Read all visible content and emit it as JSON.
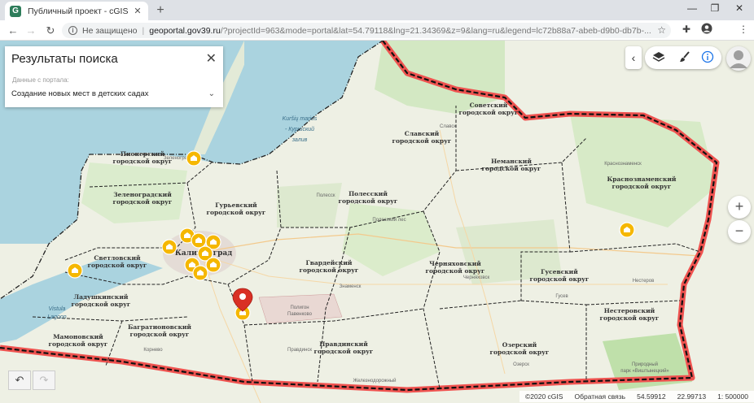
{
  "browser": {
    "tab_title": "Публичный проект - cGIS",
    "tab_favicon": "G",
    "tab_close": "✕",
    "new_tab": "+",
    "window_controls": [
      "—",
      "❐",
      "✕"
    ],
    "insecure_label": "Не защищено",
    "url_host": "geoportal.gov39.ru",
    "url_path": "/?projectId=963&mode=portal&lat=54.79118&lng=21.34369&z=9&lang=ru&legend=lc72b88a7-abeb-d9b0-db7b-..."
  },
  "search_panel": {
    "title": "Результаты поиска",
    "source_label": "Данные с портала:",
    "selected_layer": "Создание новых мест в детских садах"
  },
  "map": {
    "districts": [
      {
        "label_lines": [
          "Советский",
          "городской округ"
        ]
      },
      {
        "label_lines": [
          "Славский",
          "городской округ"
        ]
      },
      {
        "label_lines": [
          "Неманский",
          "городской округ"
        ]
      },
      {
        "label_lines": [
          "Краснознаменский",
          "городской округ"
        ]
      },
      {
        "label_lines": [
          "Пионерский",
          "городской округ"
        ]
      },
      {
        "label_lines": [
          "Зеленоградский",
          "городской округ"
        ]
      },
      {
        "label_lines": [
          "Гурьевский",
          "городской округ"
        ]
      },
      {
        "label_lines": [
          "Полесский",
          "городской округ"
        ]
      },
      {
        "label_lines": [
          "Светловский",
          "городской округ"
        ]
      },
      {
        "label_lines": [
          "Гвардейский",
          "городской округ"
        ]
      },
      {
        "label_lines": [
          "Черняховский",
          "городской округ"
        ]
      },
      {
        "label_lines": [
          "Гусевский",
          "городской округ"
        ]
      },
      {
        "label_lines": [
          "Ладушкинский",
          "городской округ"
        ]
      },
      {
        "label_lines": [
          "Нестеровский",
          "городской округ"
        ]
      },
      {
        "label_lines": [
          "Багратионовский",
          "городской округ"
        ]
      },
      {
        "label_lines": [
          "Мамоновский",
          "городской округ"
        ]
      },
      {
        "label_lines": [
          "Правдинский",
          "городской округ"
        ]
      },
      {
        "label_lines": [
          "Озерский",
          "городской округ"
        ]
      }
    ],
    "water_labels": [
      "Kuršių marios",
      "- Куршский",
      "залив"
    ],
    "city_label": "Калининград",
    "polygon_label": [
      "Полигон",
      "Павенково"
    ],
    "park_label": [
      "Природный",
      "парк «Виштынецкий»"
    ],
    "small_labels": [
      "Славск",
      "Краснознаменск",
      "Полесск",
      "Знаменск",
      "Черняховск",
      "Нестеров",
      "Гусев",
      "Озерск",
      "Железнодорожный",
      "Правдинск",
      "Корнево",
      "Полесский лес",
      "Зеленоградск"
    ],
    "vistula_label": [
      "Vistula",
      "Lagoon"
    ]
  },
  "controls": {
    "collapse": "‹",
    "layers_icon": "layers-icon",
    "brush_icon": "brush-icon",
    "info_icon": "info-icon",
    "zoom_in": "+",
    "zoom_out": "−",
    "undo": "↶",
    "redo": "↷"
  },
  "status": {
    "copyright": "©2020 cGIS",
    "feedback": "Обратная связь",
    "lat": "54.59912",
    "lng": "22.99713",
    "scale": "1: 500000"
  },
  "colors": {
    "border_highlight": "#ef5350",
    "marker": "#f5b700",
    "pin": "#d93025",
    "land": "#eef0e4",
    "forest": "#cfe6bd",
    "sea": "#aad3df"
  },
  "markers_count_visible": 12
}
